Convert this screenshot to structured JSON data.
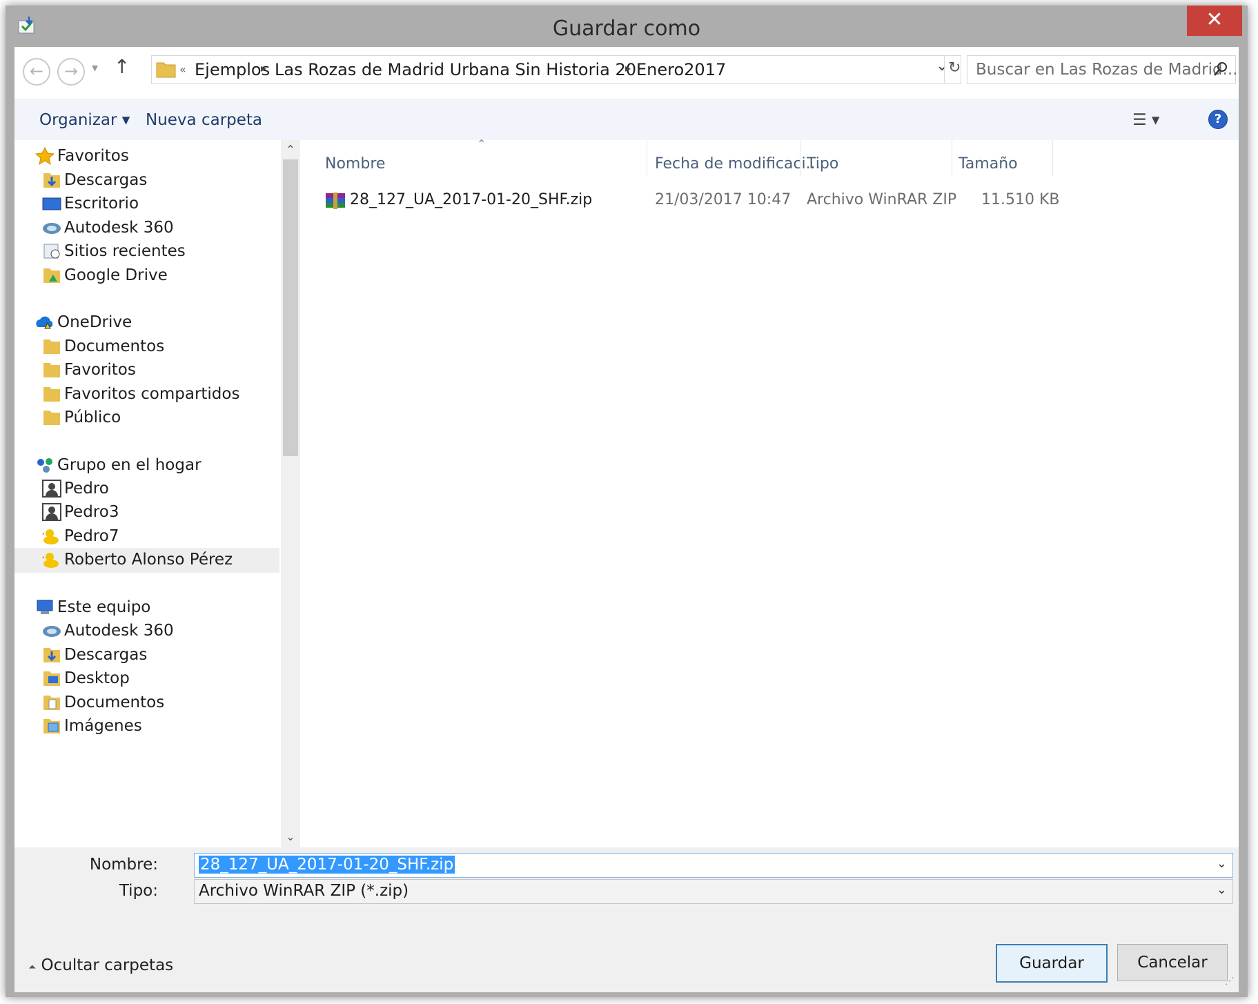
{
  "window": {
    "title": "Guardar como",
    "close_glyph": "✕"
  },
  "nav": {
    "back_glyph": "←",
    "forward_glyph": "→",
    "recent_glyph": "▾",
    "up_glyph": "↑",
    "breadcrumb": {
      "overflow": "«",
      "items": [
        "Ejemplos",
        "Las Rozas de Madrid Urbana Sin Historia 20Enero2017"
      ],
      "sep": "▸",
      "dropdown_glyph": "⌄",
      "refresh_glyph": "↻"
    },
    "search": {
      "placeholder": "Buscar en Las Rozas de Madrid...",
      "icon": "search-icon"
    }
  },
  "toolbar": {
    "organize": "Organizar ▾",
    "new_folder": "Nueva carpeta",
    "views_glyph": "☰ ▾",
    "help_glyph": "?"
  },
  "sidebar": {
    "favorites": {
      "label": "Favoritos",
      "items": [
        "Descargas",
        "Escritorio",
        "Autodesk 360",
        "Sitios recientes",
        "Google Drive"
      ]
    },
    "onedrive": {
      "label": "OneDrive",
      "items": [
        "Documentos",
        "Favoritos",
        "Favoritos compartidos",
        "Público"
      ]
    },
    "homegroup": {
      "label": "Grupo en el hogar",
      "items": [
        "Pedro",
        "Pedro3",
        "Pedro7",
        "Roberto Alonso Pérez"
      ]
    },
    "thispc": {
      "label": "Este equipo",
      "items": [
        "Autodesk 360",
        "Descargas",
        "Desktop",
        "Documentos",
        "Imágenes"
      ]
    },
    "scroll_up": "⌃",
    "scroll_down": "⌄"
  },
  "list": {
    "sort_glyph": "⌃",
    "columns": [
      "Nombre",
      "Fecha de modificaci...",
      "Tipo",
      "Tamaño"
    ],
    "rows": [
      {
        "name": "28_127_UA_2017-01-20_SHF.zip",
        "date": "21/03/2017 10:47",
        "type": "Archivo WinRAR ZIP",
        "size": "11.510 KB"
      }
    ]
  },
  "form": {
    "name_label": "Nombre:",
    "name_value": "28_127_UA_2017-01-20_SHF.zip",
    "type_label": "Tipo:",
    "type_value": "Archivo WinRAR ZIP (*.zip)",
    "dropdown_glyph": "⌄"
  },
  "footer": {
    "hide_folders_glyph": "⏶",
    "hide_folders": "Ocultar carpetas",
    "save": "Guardar",
    "cancel": "Cancelar"
  },
  "colors": {
    "accent": "#3399ff",
    "close": "#c7403a",
    "toolbar_bg": "#f1f5fb",
    "chrome": "#adadad"
  }
}
